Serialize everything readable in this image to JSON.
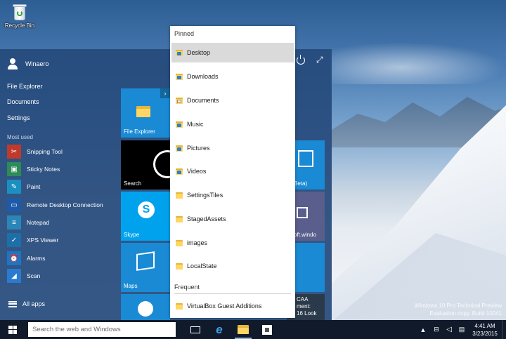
{
  "desktop": {
    "recycle_bin_label": "Recycle Bin",
    "watermark_line1": "Windows 10 Pro Technical Preview",
    "watermark_line2": "Evaluation copy. Build 10041"
  },
  "start_menu": {
    "user_name": "Winaero",
    "links": [
      "File Explorer",
      "Documents",
      "Settings"
    ],
    "most_used_heading": "Most used",
    "most_used": [
      {
        "label": "Snipping Tool",
        "icon": "scissors-icon",
        "color": "#c0392b"
      },
      {
        "label": "Sticky Notes",
        "icon": "sticky-note-icon",
        "color": "#2e8b57"
      },
      {
        "label": "Paint",
        "icon": "palette-icon",
        "color": "#1b8fbf"
      },
      {
        "label": "Remote Desktop Connection",
        "icon": "remote-desktop-icon",
        "color": "#1e5aa8"
      },
      {
        "label": "Notepad",
        "icon": "notepad-icon",
        "color": "#2a86b8"
      },
      {
        "label": "XPS Viewer",
        "icon": "xps-icon",
        "color": "#1d6fa8"
      },
      {
        "label": "Alarms",
        "icon": "alarm-icon",
        "color": "#1f74c4"
      },
      {
        "label": "Scan",
        "icon": "scan-icon",
        "color": "#2a7bd0"
      }
    ],
    "all_apps_label": "All apps",
    "tiles": {
      "file_explorer": "File Explorer",
      "search": "Search",
      "skype": "Skype",
      "maps": "Maps",
      "store_partial": "Beta)",
      "windows_partial": "oft.windo",
      "news_partial_1": "CAA",
      "news_partial_2": "ment:",
      "news_partial_3": "16 Look"
    }
  },
  "jump_list": {
    "pinned_heading": "Pinned",
    "pinned": [
      {
        "label": "Desktop",
        "badge": "#2d7fd3",
        "selected": true
      },
      {
        "label": "Downloads",
        "badge": "#2d7fd3"
      },
      {
        "label": "Documents",
        "badge": "#8a8a8a"
      },
      {
        "label": "Music",
        "badge": "#2d7fd3"
      },
      {
        "label": "Pictures",
        "badge": "#2d7fd3"
      },
      {
        "label": "Videos",
        "badge": "#2d7fd3"
      },
      {
        "label": "SettingsTiles",
        "badge": ""
      },
      {
        "label": "StagedAssets",
        "badge": ""
      },
      {
        "label": "images",
        "badge": ""
      },
      {
        "label": "LocalState",
        "badge": ""
      }
    ],
    "frequent_heading": "Frequent",
    "frequent": [
      {
        "label": "VirtualBox Guest Additions",
        "badge": ""
      }
    ]
  },
  "taskbar": {
    "search_placeholder": "Search the web and Windows",
    "clock_time": "4:41 AM",
    "clock_date": "3/23/2015"
  },
  "colors": {
    "start_bg": "#264a7c",
    "tile_blue": "#1a8ad4",
    "taskbar_bg": "#101a2b",
    "skype_blue": "#00a2ed",
    "selected_row": "#dadada"
  }
}
